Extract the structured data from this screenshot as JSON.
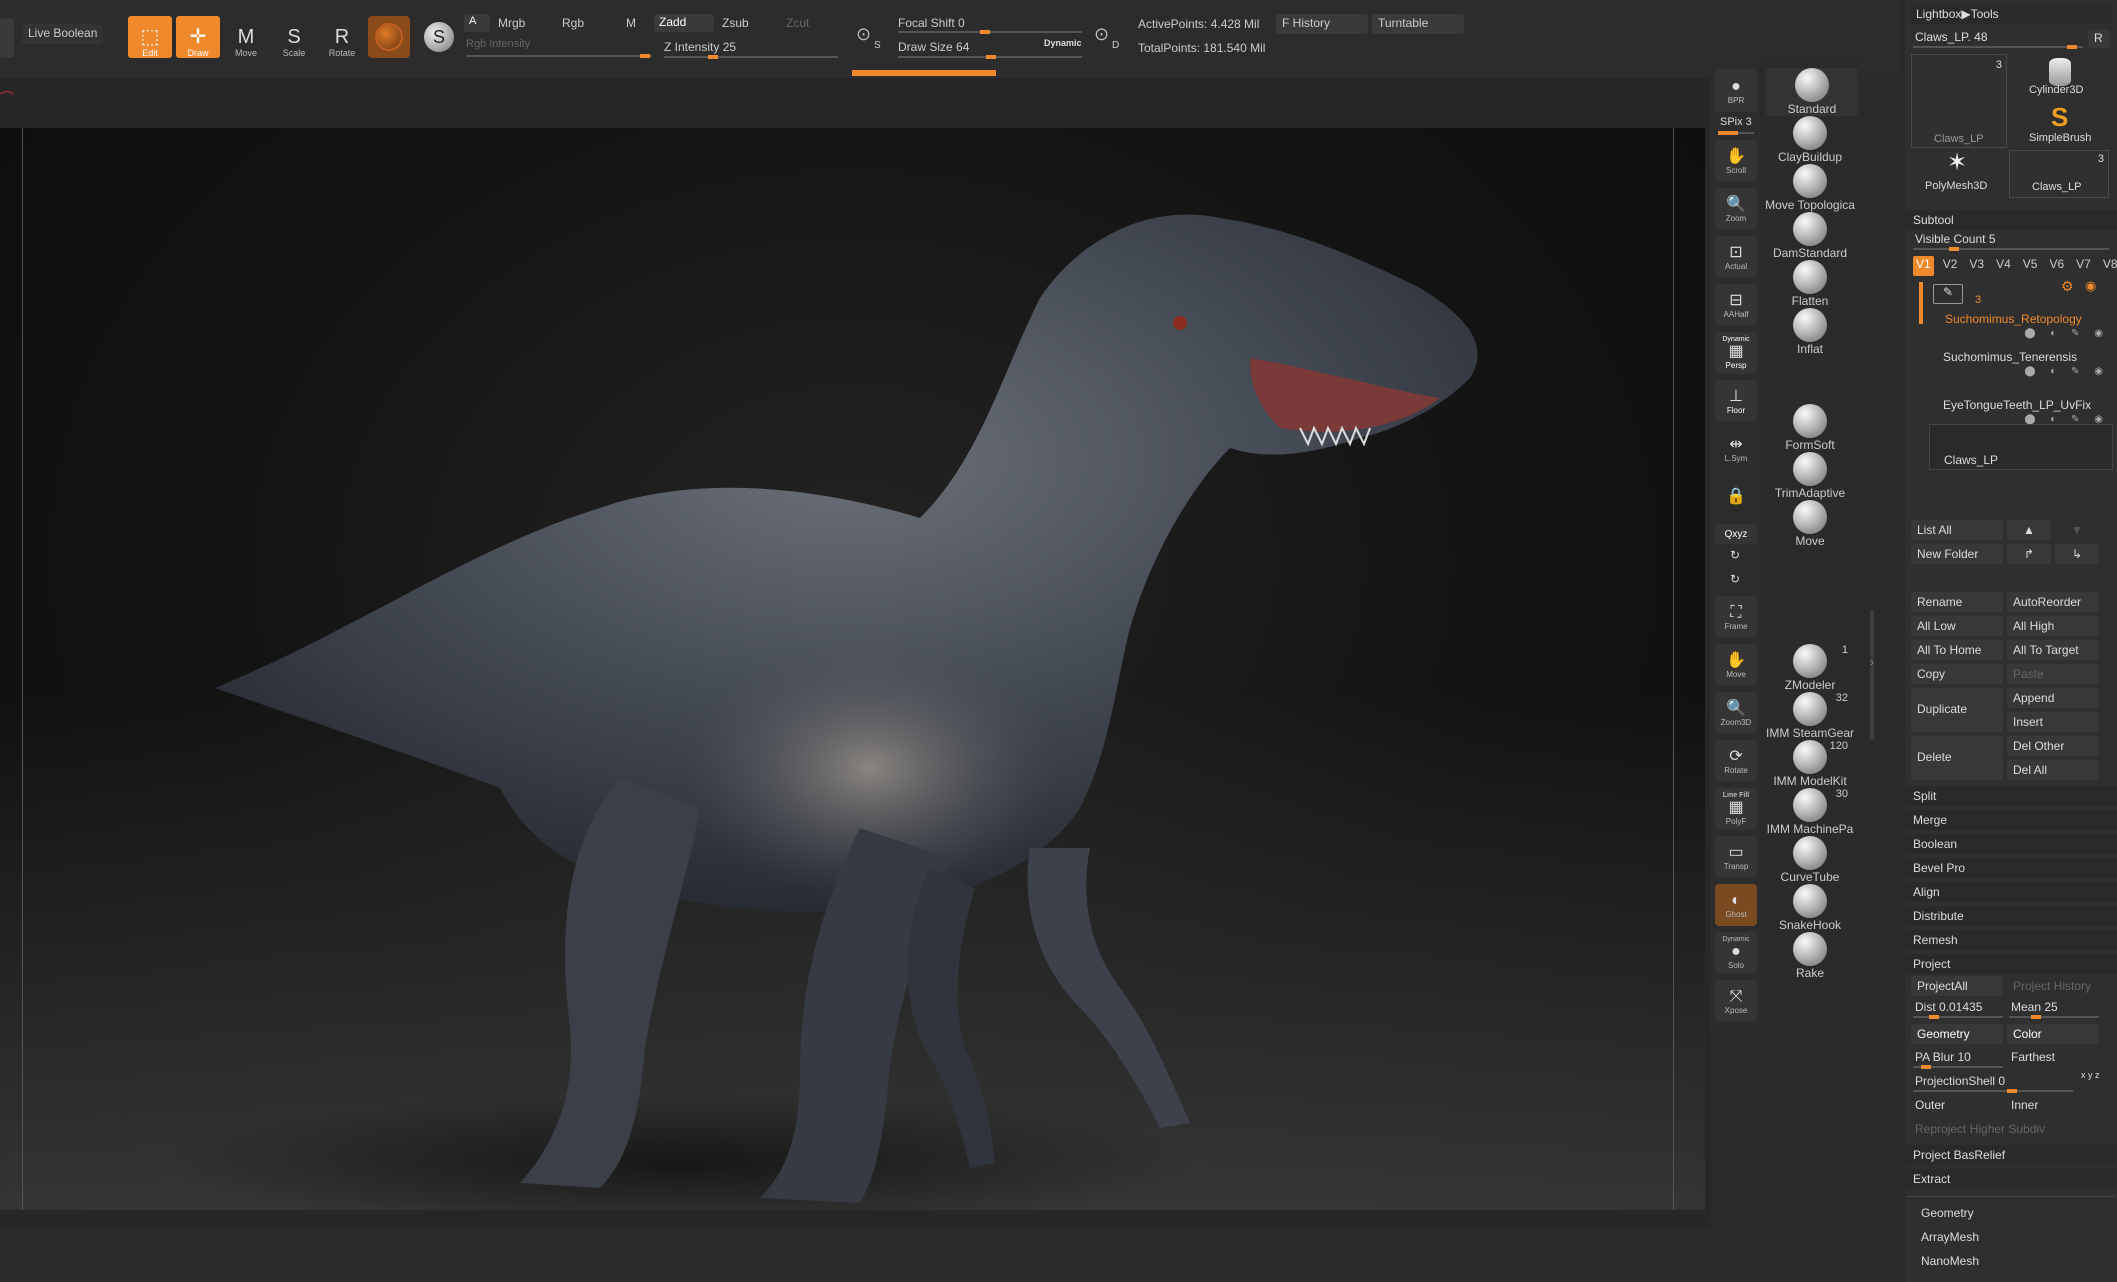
{
  "toolbar": {
    "live_boolean": "Live Boolean",
    "edit": "Edit",
    "draw": "Draw",
    "move": "Move",
    "scale": "Scale",
    "rotate": "Rotate",
    "mode_a": "A",
    "mrgb": "Mrgb",
    "rgb": "Rgb",
    "m": "M",
    "rgb_intensity": "Rgb Intensity",
    "zadd": "Zadd",
    "zsub": "Zsub",
    "zcut": "Zcut",
    "z_intensity": "Z Intensity 25",
    "s_label": "S",
    "d_label": "D",
    "focal_shift": "Focal Shift 0",
    "draw_size": "Draw Size 64",
    "dynamic": "Dynamic",
    "active_points": "ActivePoints: 4.428 Mil",
    "total_points": "TotalPoints: 181.540 Mil",
    "f_history": "F History",
    "turntable": "Turntable",
    "z_intensity_value": 0.25,
    "draw_size_value": 0.64,
    "focal_shift_value": 0.5
  },
  "shelf": {
    "bpr": "BPR",
    "spix": "SPix 3",
    "scroll": "Scroll",
    "zoom": "Zoom",
    "actual": "Actual",
    "aahalf": "AAHalf",
    "dynamic": "Dynamic",
    "persp": "Persp",
    "floor": "Floor",
    "lsym": "L.Sym",
    "xyz": "Qxyz",
    "frame": "Frame",
    "move": "Move",
    "zoom3d": "Zoom3D",
    "rotate": "Rotate",
    "line_fill": "Line Fill",
    "polyf": "PolyF",
    "transp": "Transp",
    "ghost": "Ghost",
    "dynamic2": "Dynamic",
    "solo": "Solo",
    "xpose": "Xpose"
  },
  "brushes": [
    {
      "name": "Standard",
      "count": ""
    },
    {
      "name": "ClayBuildup",
      "count": ""
    },
    {
      "name": "Move Topologica",
      "count": ""
    },
    {
      "name": "DamStandard",
      "count": ""
    },
    {
      "name": "Flatten",
      "count": ""
    },
    {
      "name": "Inflat",
      "count": ""
    },
    {
      "name": "FormSoft",
      "count": ""
    },
    {
      "name": "TrimAdaptive",
      "count": ""
    },
    {
      "name": "Move",
      "count": ""
    },
    {
      "name": "ZModeler",
      "count": "1"
    },
    {
      "name": "IMM SteamGear",
      "count": "32"
    },
    {
      "name": "IMM ModelKit",
      "count": "120"
    },
    {
      "name": "IMM MachinePa",
      "count": "30"
    },
    {
      "name": "CurveTube",
      "count": ""
    },
    {
      "name": "SnakeHook",
      "count": ""
    },
    {
      "name": "Rake",
      "count": ""
    }
  ],
  "panel": {
    "lightbox": "Lightbox▶Tools",
    "current_tool": "Claws_LP. 48",
    "r": "R",
    "tools": [
      {
        "name": "Claws_LP",
        "count": "3"
      },
      {
        "name": "Cylinder3D",
        "count": ""
      },
      {
        "name": "SimpleBrush",
        "count": ""
      },
      {
        "name": "PolyMesh3D",
        "count": ""
      },
      {
        "name": "Claws_LP",
        "count": "3"
      }
    ],
    "subtool_header": "Subtool",
    "visible_count": "Visible Count 5",
    "versions": [
      "V1",
      "V2",
      "V3",
      "V4",
      "V5",
      "V6",
      "V7",
      "V8"
    ],
    "subtools": [
      {
        "name": "Suchomimus_Retopology",
        "count": "3",
        "active": true
      },
      {
        "name": "Suchomimus_Tenerensis",
        "count": "",
        "active": false
      },
      {
        "name": "EyeTongueTeeth_LP_UvFix",
        "count": "",
        "active": false
      },
      {
        "name": "Claws_LP",
        "count": "",
        "active": false
      }
    ],
    "list_all": "List All",
    "new_folder": "New Folder",
    "rename": "Rename",
    "autoreorder": "AutoReorder",
    "all_low": "All Low",
    "all_high": "All High",
    "all_to_home": "All To Home",
    "all_to_target": "All To Target",
    "copy": "Copy",
    "paste": "Paste",
    "duplicate": "Duplicate",
    "append": "Append",
    "insert": "Insert",
    "delete": "Delete",
    "del_other": "Del Other",
    "del_all": "Del All",
    "split": "Split",
    "merge": "Merge",
    "boolean": "Boolean",
    "bevel_pro": "Bevel Pro",
    "align": "Align",
    "distribute": "Distribute",
    "remesh": "Remesh",
    "project": "Project",
    "project_all": "ProjectAll",
    "project_history": "Project History",
    "dist": "Dist 0.01435",
    "mean": "Mean 25",
    "geometry_btn": "Geometry",
    "color_btn": "Color",
    "pa_blur": "PA Blur 10",
    "farthest": "Farthest",
    "projection_shell": "ProjectionShell 0",
    "xyz": "x y z",
    "outer": "Outer",
    "inner": "Inner",
    "reproject": "Reproject Higher Subdiv",
    "project_basrelief": "Project BasRelief",
    "extract": "Extract",
    "geometry": "Geometry",
    "arraymesh": "ArrayMesh",
    "nanomesh": "NanoMesh"
  },
  "colors": {
    "accent": "#f0892b",
    "panel_bg": "#2f2f2f",
    "viewport_bg": "#131313",
    "dino_body": "#3f4651"
  }
}
